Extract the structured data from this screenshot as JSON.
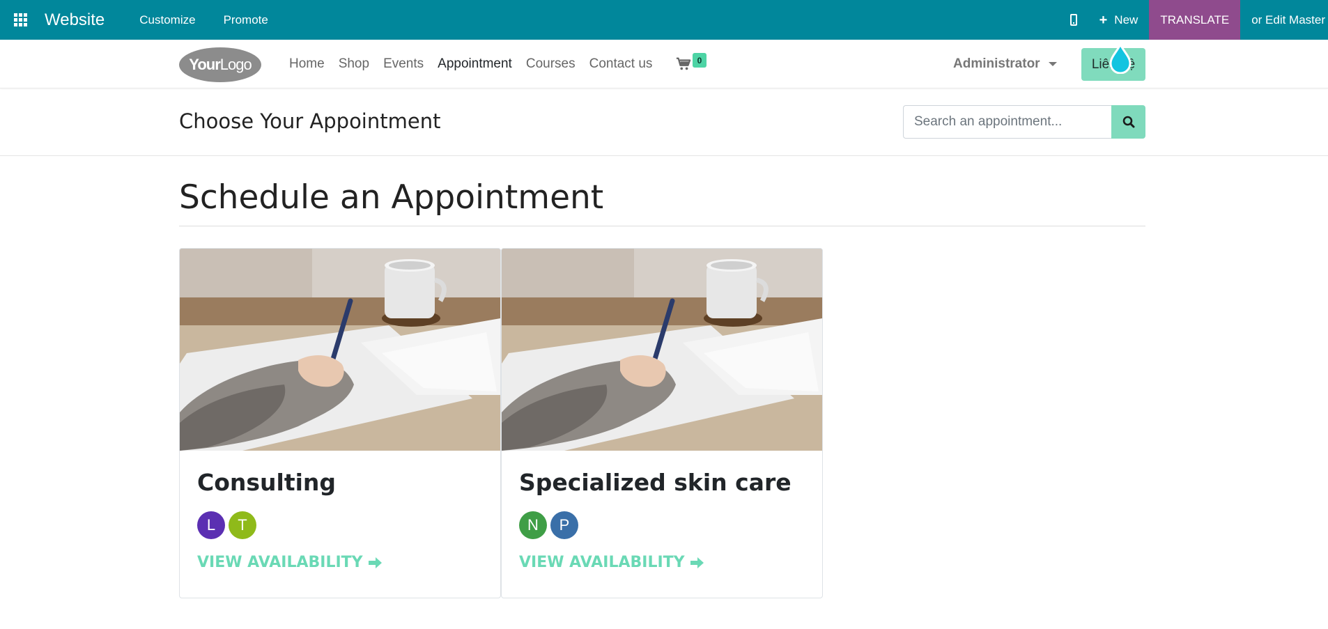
{
  "admin_bar": {
    "brand": "Website",
    "customize": "Customize",
    "promote": "Promote",
    "new": "New",
    "translate": "TRANSLATE",
    "edit_master": "or Edit Master",
    "colors": {
      "bar": "#01879b",
      "translate": "#8f4b8d"
    }
  },
  "header": {
    "logo_bold": "Your",
    "logo_thin": "Logo",
    "nav": [
      {
        "label": "Home",
        "active": false
      },
      {
        "label": "Shop",
        "active": false
      },
      {
        "label": "Events",
        "active": false
      },
      {
        "label": "Appointment",
        "active": true
      },
      {
        "label": "Courses",
        "active": false
      },
      {
        "label": "Contact us",
        "active": false
      }
    ],
    "cart_count": "0",
    "user": "Administrator",
    "cta": "Liên hệ"
  },
  "subheader": {
    "title": "Choose Your Appointment",
    "search_placeholder": "Search an appointment..."
  },
  "main": {
    "heading": "Schedule an Appointment",
    "cards": [
      {
        "title": "Consulting",
        "avatars": [
          {
            "initial": "L",
            "color": "#5b2fb2"
          },
          {
            "initial": "T",
            "color": "#8fba1a"
          }
        ],
        "link": "VIEW AVAILABILITY"
      },
      {
        "title": "Specialized skin care",
        "avatars": [
          {
            "initial": "N",
            "color": "#3f9e46"
          },
          {
            "initial": "P",
            "color": "#3a6fa8"
          }
        ],
        "link": "VIEW AVAILABILITY"
      }
    ]
  },
  "icons": [
    "apps-icon",
    "mobile-icon",
    "plus-icon",
    "cart-icon",
    "caret-down-icon",
    "search-icon",
    "arrow-right-icon",
    "drop-icon"
  ]
}
